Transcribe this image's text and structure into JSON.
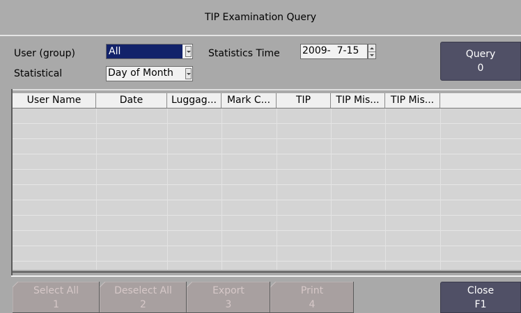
{
  "title": "TIP Examination Query",
  "filters": {
    "user_group_label": "User (group)",
    "user_group_value": "All",
    "statistical_label": "Statistical",
    "statistical_value": "Day of Month",
    "stat_time_label": "Statistics Time",
    "stat_time_value": "2009-  7-15"
  },
  "query_button": {
    "label": "Query",
    "key": "0"
  },
  "table": {
    "columns": [
      "User Name",
      "Date",
      "Luggag...",
      "Mark C...",
      "TIP",
      "TIP Mis...",
      "TIP Mis...",
      ""
    ],
    "rows": []
  },
  "footer": {
    "buttons": [
      {
        "label": "Select All",
        "key": "1",
        "enabled": false
      },
      {
        "label": "Deselect All",
        "key": "2",
        "enabled": false
      },
      {
        "label": "Export",
        "key": "3",
        "enabled": false
      },
      {
        "label": "Print",
        "key": "4",
        "enabled": false
      }
    ],
    "close": {
      "label": "Close",
      "key": "F1"
    }
  },
  "colors": {
    "background": "#a9a9a9",
    "selection": "#12226a",
    "dark_button": "#505066",
    "disabled_button": "#a8a0a0"
  }
}
